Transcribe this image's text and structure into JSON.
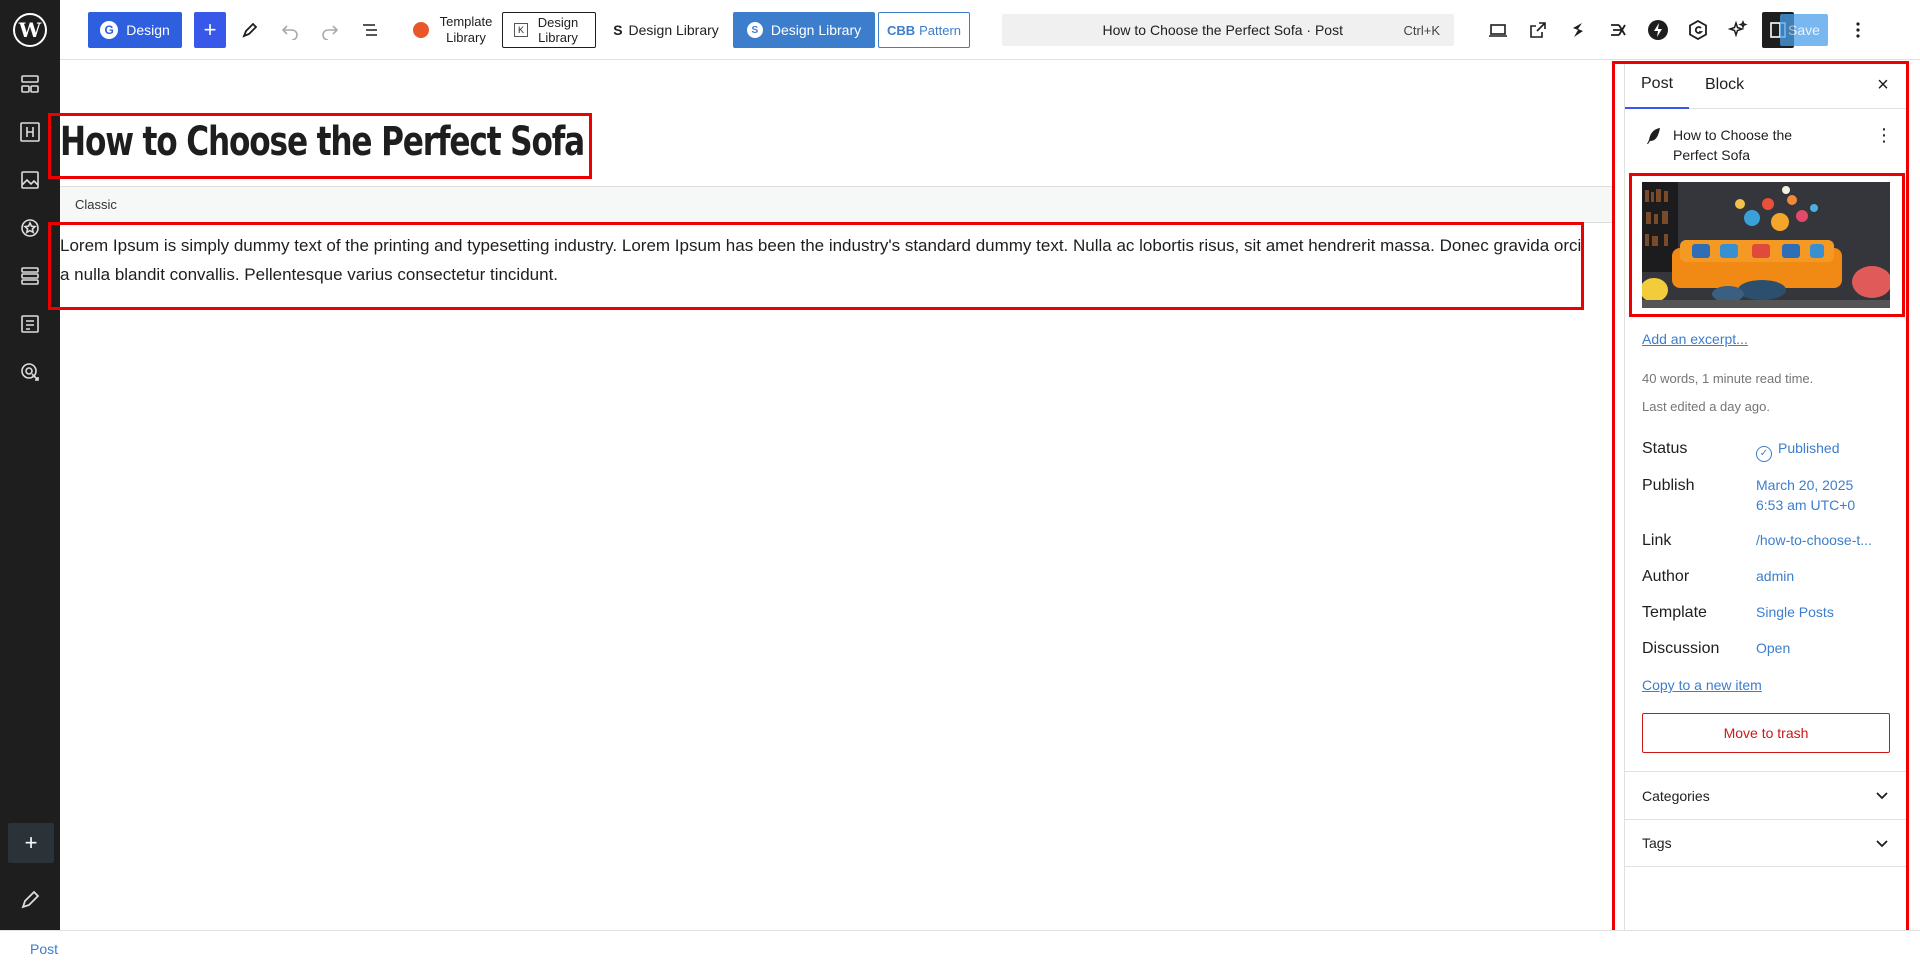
{
  "toolbar": {
    "design_label": "Design",
    "template_library_label": "Template Library",
    "design_library_1_label": "Design Library",
    "design_library_2_label": "Design Library",
    "design_library_3_label": "Design Library",
    "pattern_prefix": "CBB",
    "pattern_label": "Pattern",
    "command_title": "How to Choose the Perfect Sofa · Post",
    "command_shortcut": "Ctrl+K",
    "save_label": "Save"
  },
  "editor": {
    "title": "How to Choose the Perfect Sofa",
    "classic_label": "Classic",
    "body": "Lorem Ipsum is simply dummy text of the printing and typesetting industry. Lorem Ipsum has been the industry's standard dummy text. Nulla ac lobortis risus, sit amet hendrerit massa. Donec gravida orci a nulla blandit convallis. Pellentesque varius consectetur tincidunt."
  },
  "sidebar": {
    "tabs": [
      "Post",
      "Block"
    ],
    "close_label": "×",
    "post_name": "How to Choose the Perfect Sofa",
    "add_excerpt": "Add an excerpt...",
    "word_count": "40 words, 1 minute read time.",
    "last_edited": "Last edited a day ago.",
    "rows": [
      {
        "label": "Status",
        "value": "Published"
      },
      {
        "label": "Publish",
        "value": "March 20, 2025",
        "value2": "6:53 am UTC+0"
      },
      {
        "label": "Link",
        "value": "/how-to-choose-t..."
      },
      {
        "label": "Author",
        "value": "admin"
      },
      {
        "label": "Template",
        "value": "Single Posts"
      },
      {
        "label": "Discussion",
        "value": "Open"
      }
    ],
    "copy_link": "Copy to a new item",
    "trash_label": "Move to trash",
    "panels": [
      "Categories",
      "Tags"
    ]
  },
  "footer": {
    "breadcrumb": "Post"
  },
  "colors": {
    "accent": "#3858e9",
    "highlight": "#ee0000",
    "link": "#3c7ecb",
    "danger": "#cc1818",
    "rail": "#1e1e1e"
  }
}
